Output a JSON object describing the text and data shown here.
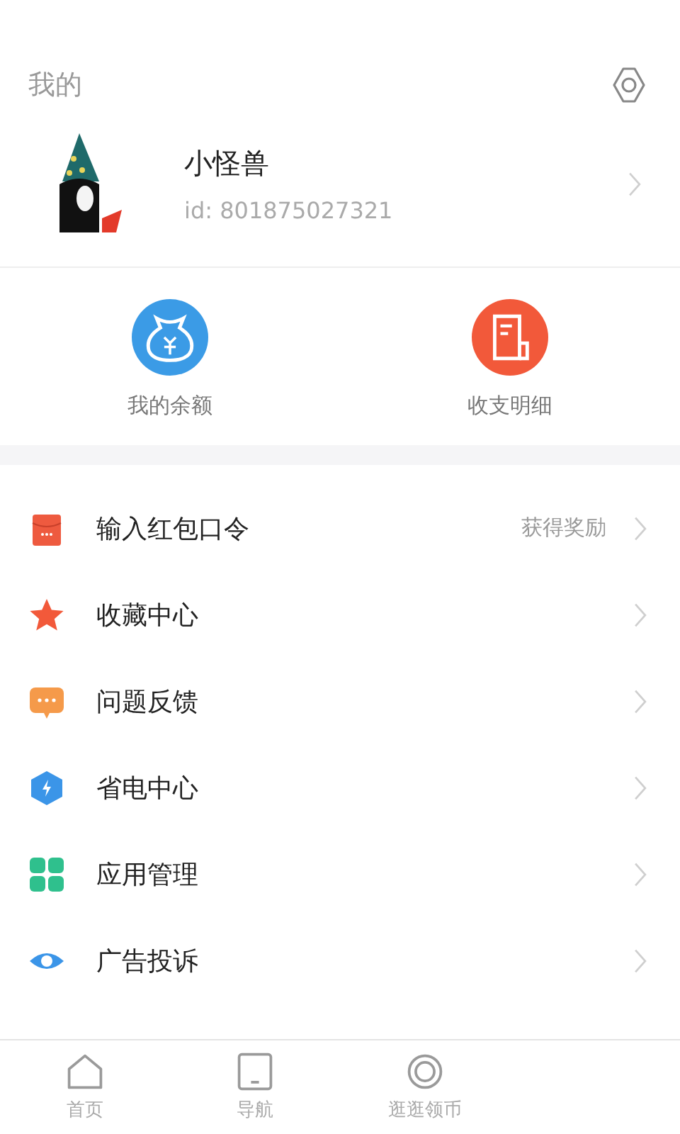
{
  "header": {
    "title": "我的"
  },
  "profile": {
    "name": "小怪兽",
    "id": "id: 801875027321"
  },
  "quick_actions": [
    {
      "kind": "wallet",
      "label": "我的余额",
      "color": "#3b9be6"
    },
    {
      "kind": "bill",
      "label": "收支明细",
      "color": "#f2593a"
    }
  ],
  "menu": [
    {
      "kind": "envelope",
      "label": "输入红包口令",
      "hint": "获得奖励"
    },
    {
      "kind": "star",
      "label": "收藏中心"
    },
    {
      "kind": "chat",
      "label": "问题反馈"
    },
    {
      "kind": "bolt",
      "label": "省电中心"
    },
    {
      "kind": "apps",
      "label": "应用管理"
    },
    {
      "kind": "eye",
      "label": "广告投诉"
    }
  ],
  "tab_bar": [
    {
      "kind": "home",
      "label": "首页",
      "selected": false
    },
    {
      "kind": "tablet",
      "label": "导航",
      "selected": false
    },
    {
      "kind": "coin",
      "label": "逛逛领币",
      "selected": false
    }
  ]
}
